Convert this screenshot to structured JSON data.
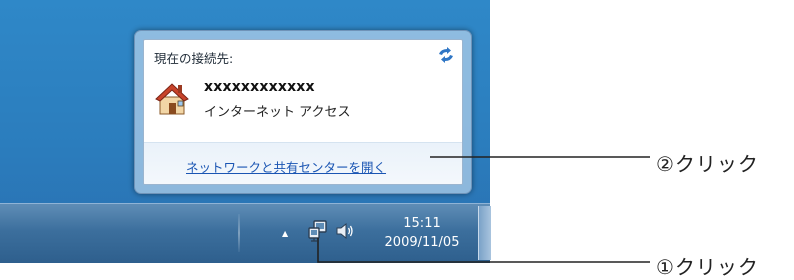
{
  "flyout": {
    "header": "現在の接続先:",
    "network_name": "xxxxxxxxxxxx",
    "access_type": "インターネット アクセス",
    "open_link": "ネットワークと共有センターを開く",
    "refresh_icon": "refresh-arrows-icon",
    "network_icon": "house-icon"
  },
  "taskbar": {
    "clock_time": "15:11",
    "clock_date": "2009/11/05",
    "tray_icons": [
      "show-hidden-icons-arrow",
      "network-icon",
      "volume-icon"
    ]
  },
  "callouts": {
    "step1": "①クリック",
    "step2": "②クリック"
  },
  "colors": {
    "desktop": "#2b7dbd",
    "link": "#1a55b3",
    "callout_line": "#222222"
  }
}
